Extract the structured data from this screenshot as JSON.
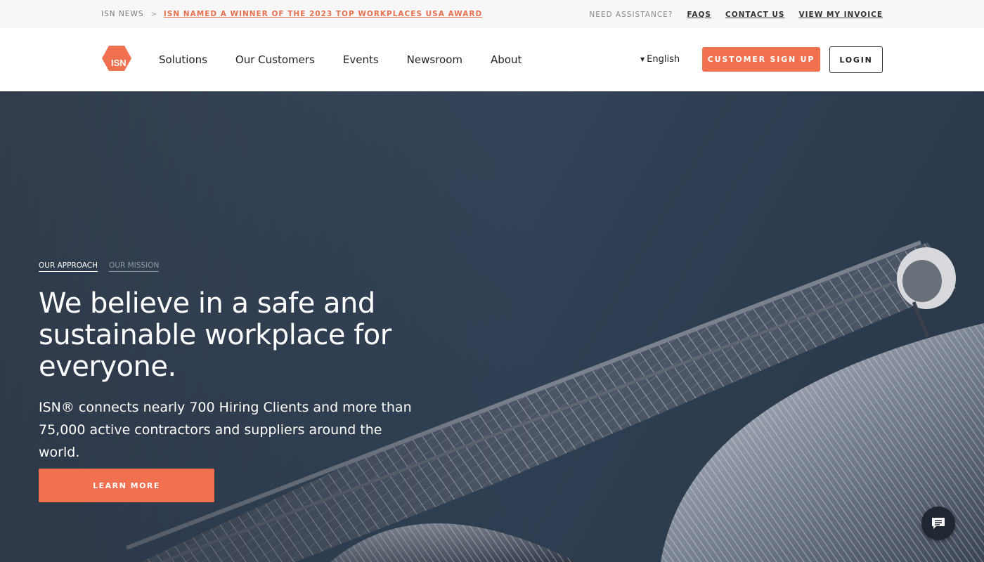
{
  "utility_bar": {
    "news_label": "ISN NEWS",
    "separator": ">",
    "news_link": "ISN NAMED A WINNER OF THE 2023 TOP WORKPLACES USA AWARD",
    "help_label": "NEED ASSISTANCE?",
    "links": [
      "FAQS",
      "CONTACT US",
      "VIEW MY INVOICE"
    ]
  },
  "nav": {
    "logo_text": "ISN",
    "items": [
      "Solutions",
      "Our Customers",
      "Events",
      "Newsroom",
      "About"
    ],
    "language": "English",
    "signup_label": "CUSTOMER SIGN UP",
    "login_label": "LOGIN"
  },
  "hero": {
    "tabs": [
      "OUR APPROACH",
      "OUR MISSION"
    ],
    "active_tab": "OUR APPROACH",
    "title": "We believe in a safe and sustainable workplace for everyone.",
    "subtitle": "ISN® connects nearly 700 Hiring Clients and more than 75,000 active contractors and suppliers around the world.",
    "cta_label": "LEARN MORE"
  },
  "colors": {
    "accent": "#f0704f",
    "hero_bg": "#37465b",
    "utility_bg": "#f7f7f7"
  },
  "icons": {
    "logo": "isn-hexagon-logo",
    "language_caret": "caret-down-icon",
    "chat": "chat-bubble-icon"
  }
}
